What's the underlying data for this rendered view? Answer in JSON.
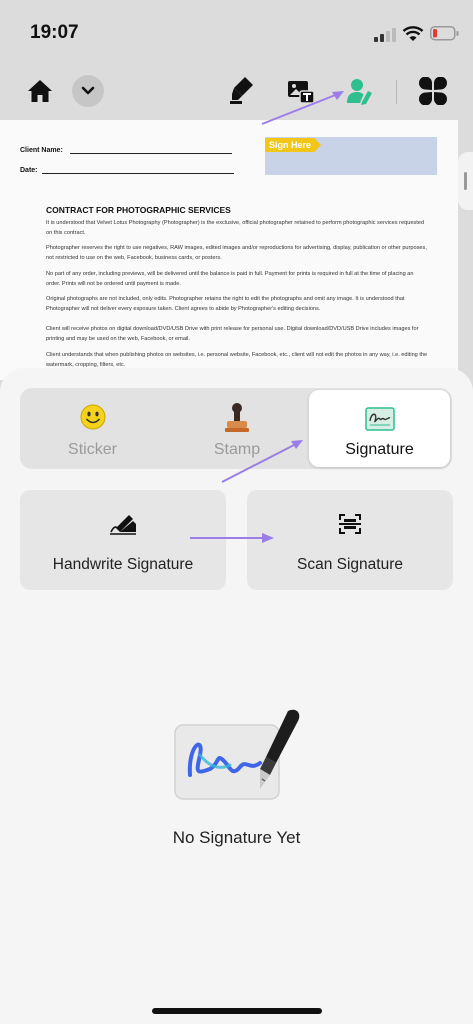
{
  "status": {
    "time": "19:07"
  },
  "toolbar": {
    "buttons": [
      "home-icon",
      "chevron-down-icon",
      "highlighter-icon",
      "text-image-icon",
      "signature-person-icon",
      "four-petal-menu-icon"
    ]
  },
  "document": {
    "client_name_label": "Client Name:",
    "date_label": "Date:",
    "sign_here": "Sign Here",
    "title": "CONTRACT FOR PHOTOGRAPHIC SERVICES",
    "paragraphs": [
      "It is understood that Velvet Lotus Photography (Photographer) is the exclusive, official photographer retained to perform photographic services requested on this contract.",
      "Photographer reserves the right to use negatives, RAW images, edited images and/or reproductions for advertising, display, publication or other purposes, not restricted to use on the web, Facebook, business cards, or posters.",
      "No part of any order, including previews, will be delivered until the balance is paid in full. Payment for prints is required in full at the time of placing an order. Prints will not be ordered until payment is made.",
      "Original photographs are not included, only edits. Photographer retains the right to edit the photographs and omit any image. It is understood that Photographer will not deliver every exposure taken. Client agrees to abide by Photographer's editing decisions.",
      "Client will receive photos on digital download/DVD/USB Drive with print release for personal use. Digital download/DVD/USB Drive includes images for printing and may be used on the web, Facebook, or email.",
      "Client understands that when publishing photos on websites, i.e. personal website, Facebook, etc., client will not edit the photos in any way, i.e. editing the watermark, cropping, filters, etc."
    ]
  },
  "tabs": {
    "sticker": "Sticker",
    "stamp": "Stamp",
    "signature": "Signature"
  },
  "actions": {
    "handwrite": "Handwrite Signature",
    "scan": "Scan Signature"
  },
  "empty_state": {
    "label": "No Signature Yet"
  },
  "colors": {
    "accent_green": "#2fbf8f",
    "arrow_purple": "#9b7de8",
    "sign_here_yellow": "#f2c619"
  }
}
